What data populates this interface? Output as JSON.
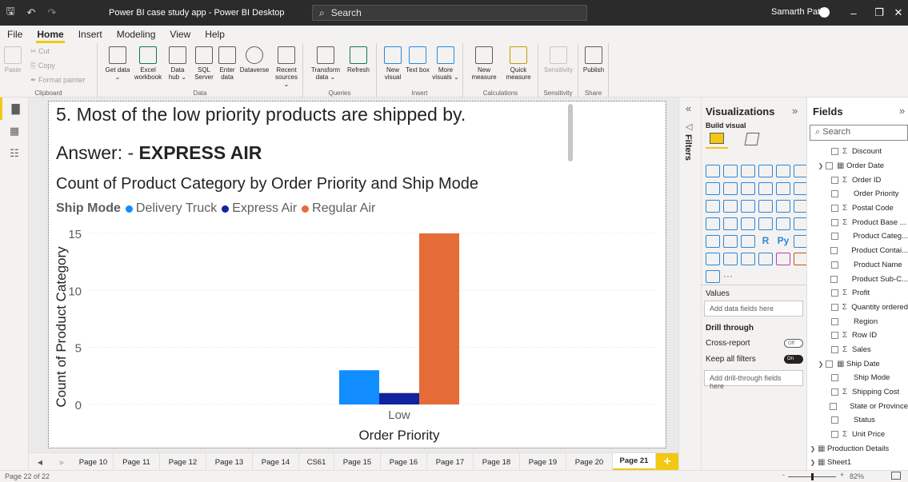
{
  "window": {
    "title": "Power BI case study app - Power BI Desktop",
    "search_placeholder": "Search",
    "user": "Samarth Patil"
  },
  "menu": {
    "items": [
      "File",
      "Home",
      "Insert",
      "Modeling",
      "View",
      "Help"
    ],
    "active": "Home"
  },
  "ribbon": {
    "clipboard": {
      "label": "Clipboard",
      "paste": "Paste",
      "cut": "Cut",
      "copy": "Copy",
      "format_painter": "Format painter"
    },
    "data": {
      "label": "Data",
      "buttons": [
        "Get data ⌄",
        "Excel workbook",
        "Data hub ⌄",
        "SQL Server",
        "Enter data",
        "Dataverse",
        "Recent sources ⌄"
      ]
    },
    "queries": {
      "label": "Queries",
      "buttons": [
        "Transform data ⌄",
        "Refresh"
      ]
    },
    "insert": {
      "label": "Insert",
      "buttons": [
        "New visual",
        "Text box",
        "More visuals ⌄"
      ]
    },
    "calculations": {
      "label": "Calculations",
      "buttons": [
        "New measure",
        "Quick measure"
      ]
    },
    "sensitivity": {
      "label": "Sensitivity",
      "buttons": [
        "Sensitivity"
      ]
    },
    "share": {
      "label": "Share",
      "buttons": [
        "Publish"
      ]
    }
  },
  "report": {
    "question": "5. Most of the low priority products are shipped by.",
    "answer_prefix": "Answer: - ",
    "answer_value": "EXPRESS AIR"
  },
  "chart_data": {
    "type": "bar",
    "title": "Count of Product Category by Order Priority and Ship Mode",
    "legend_title": "Ship Mode",
    "legend_position": "top-left",
    "categories": [
      "Low"
    ],
    "series": [
      {
        "name": "Delivery Truck",
        "values": [
          3
        ],
        "color": "#118dff"
      },
      {
        "name": "Express Air",
        "values": [
          1
        ],
        "color": "#12239e"
      },
      {
        "name": "Regular Air",
        "values": [
          15
        ],
        "color": "#e66c37"
      }
    ],
    "xlabel": "Order Priority",
    "ylabel": "Count of Product Category",
    "ylim": [
      0,
      15
    ],
    "yticks": [
      0,
      5,
      10,
      15
    ],
    "grid": true
  },
  "filters_label": "Filters",
  "visualizations": {
    "title": "Visualizations",
    "build_visual": "Build visual",
    "values_label": "Values",
    "values_placeholder": "Add data fields here",
    "drill_through": "Drill through",
    "cross_report": "Cross-report",
    "cross_report_state": "Off",
    "keep_filters": "Keep all filters",
    "keep_filters_state": "On",
    "drill_placeholder": "Add drill-through fields here",
    "more": "···",
    "r_label": "R",
    "py_label": "Py"
  },
  "fields": {
    "title": "Fields",
    "search_placeholder": "Search",
    "items": [
      {
        "label": "Discount",
        "kind": "sum"
      },
      {
        "label": "Order Date",
        "kind": "date"
      },
      {
        "label": "Order ID",
        "kind": "sum"
      },
      {
        "label": "Order Priority",
        "kind": "text"
      },
      {
        "label": "Postal Code",
        "kind": "sum"
      },
      {
        "label": "Product Base ...",
        "kind": "sum"
      },
      {
        "label": "Product Categ...",
        "kind": "text"
      },
      {
        "label": "Product Contai...",
        "kind": "text"
      },
      {
        "label": "Product Name",
        "kind": "text"
      },
      {
        "label": "Product Sub-C...",
        "kind": "text"
      },
      {
        "label": "Profit",
        "kind": "sum"
      },
      {
        "label": "Quantity ordered",
        "kind": "sum"
      },
      {
        "label": "Region",
        "kind": "text"
      },
      {
        "label": "Row ID",
        "kind": "sum"
      },
      {
        "label": "Sales",
        "kind": "sum"
      },
      {
        "label": "Ship Date",
        "kind": "date"
      },
      {
        "label": "Ship Mode",
        "kind": "text"
      },
      {
        "label": "Shipping Cost",
        "kind": "sum"
      },
      {
        "label": "State or Province",
        "kind": "text"
      },
      {
        "label": "Status",
        "kind": "text"
      },
      {
        "label": "Unit Price",
        "kind": "sum"
      },
      {
        "label": "Production Details",
        "kind": "table"
      },
      {
        "label": "Sheet1",
        "kind": "table"
      }
    ]
  },
  "pages": {
    "tabs": [
      "Page 10",
      "Page 11",
      "Page 12",
      "Page 13",
      "Page 14",
      "CS61",
      "Page 15",
      "Page 16",
      "Page 17",
      "Page 18",
      "Page 19",
      "Page 20",
      "Page 21"
    ],
    "active": "Page 21",
    "add": "+"
  },
  "status": {
    "page_indicator": "Page 22 of 22",
    "zoom": "82%",
    "zoom_minus": "-",
    "zoom_plus": "+"
  }
}
